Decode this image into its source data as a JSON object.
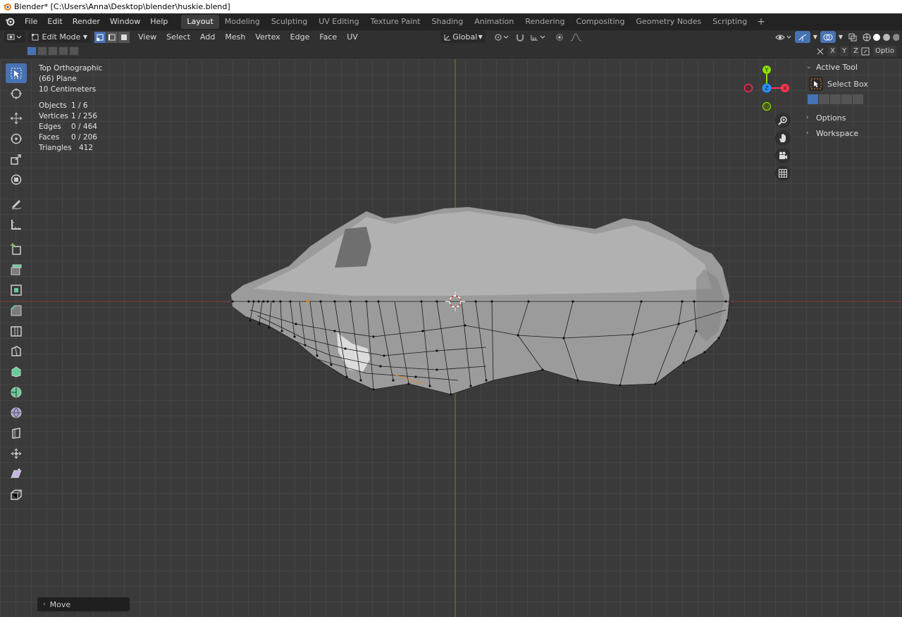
{
  "window": {
    "title": "Blender* [C:\\Users\\Anna\\Desktop\\blender\\huskie.blend]"
  },
  "menu": {
    "items": [
      "File",
      "Edit",
      "Render",
      "Window",
      "Help"
    ]
  },
  "workspaces": {
    "tabs": [
      "Layout",
      "Modeling",
      "Sculpting",
      "UV Editing",
      "Texture Paint",
      "Shading",
      "Animation",
      "Rendering",
      "Compositing",
      "Geometry Nodes",
      "Scripting"
    ],
    "active": "Layout"
  },
  "viewport_header": {
    "mode": "Edit Mode",
    "menus": [
      "View",
      "Select",
      "Add",
      "Mesh",
      "Vertex",
      "Edge",
      "Face",
      "UV"
    ],
    "orientation": "Global"
  },
  "subheader": {
    "axes": [
      "X",
      "Y",
      "Z"
    ],
    "options_label": "Optio"
  },
  "overlay": {
    "view": "Top Orthographic",
    "object": "(66) Plane",
    "scale": "10 Centimeters",
    "stats": [
      {
        "label": "Objects",
        "value": "1 / 6"
      },
      {
        "label": "Vertices",
        "value": "1 / 256"
      },
      {
        "label": "Edges",
        "value": "0 / 464"
      },
      {
        "label": "Faces",
        "value": "0 / 206"
      },
      {
        "label": "Triangles",
        "value": "412"
      }
    ]
  },
  "gizmo": {
    "x": "X",
    "y": "Y",
    "z": "Z"
  },
  "right_panel": {
    "active_tool_heading": "Active Tool",
    "tool_name": "Select Box",
    "options_heading": "Options",
    "workspace_heading": "Workspace"
  },
  "operator_panel": {
    "label": "Move"
  },
  "colors": {
    "accent": "#4772b3",
    "x_axis": "#ff3352",
    "y_axis": "#8bdc00",
    "z_axis": "#2890ff"
  }
}
